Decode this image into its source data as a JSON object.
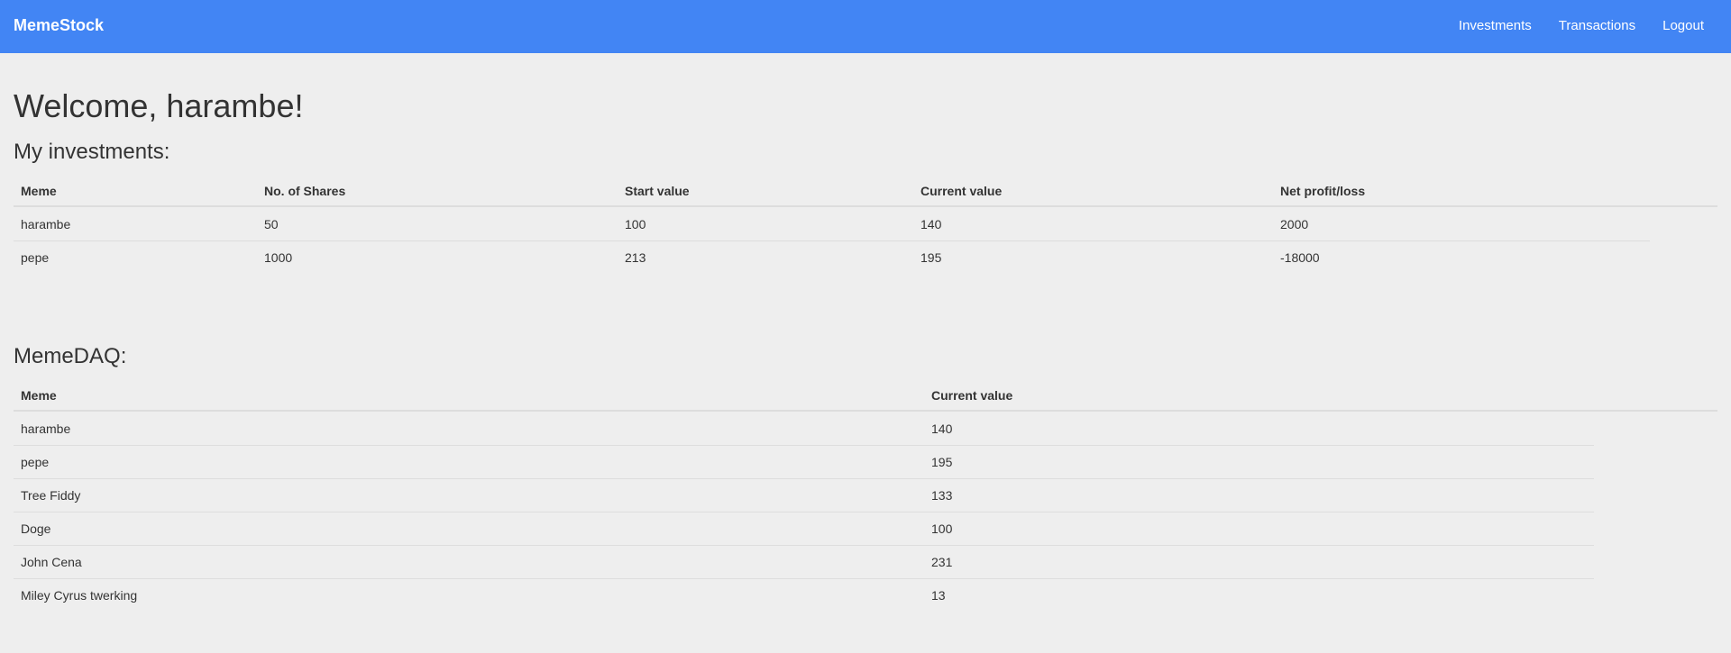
{
  "navbar": {
    "brand": "MemeStock",
    "links": [
      {
        "label": "Investments"
      },
      {
        "label": "Transactions"
      },
      {
        "label": "Logout"
      }
    ],
    "background_color": "#4285f4"
  },
  "main": {
    "welcome": "Welcome, harambe!",
    "investments": {
      "title": "My investments:",
      "headers": [
        "Meme",
        "No. of Shares",
        "Start value",
        "Current value",
        "Net profit/loss"
      ],
      "rows": [
        [
          "harambe",
          "50",
          "100",
          "140",
          "2000"
        ],
        [
          "pepe",
          "1000",
          "213",
          "195",
          "-18000"
        ]
      ]
    },
    "memedaq": {
      "title": "MemeDAQ:",
      "headers": [
        "Meme",
        "Current value"
      ],
      "rows": [
        [
          "harambe",
          "140"
        ],
        [
          "pepe",
          "195"
        ],
        [
          "Tree Fiddy",
          "133"
        ],
        [
          "Doge",
          "100"
        ],
        [
          "John Cena",
          "231"
        ],
        [
          "Miley Cyrus twerking",
          "13"
        ]
      ]
    }
  }
}
